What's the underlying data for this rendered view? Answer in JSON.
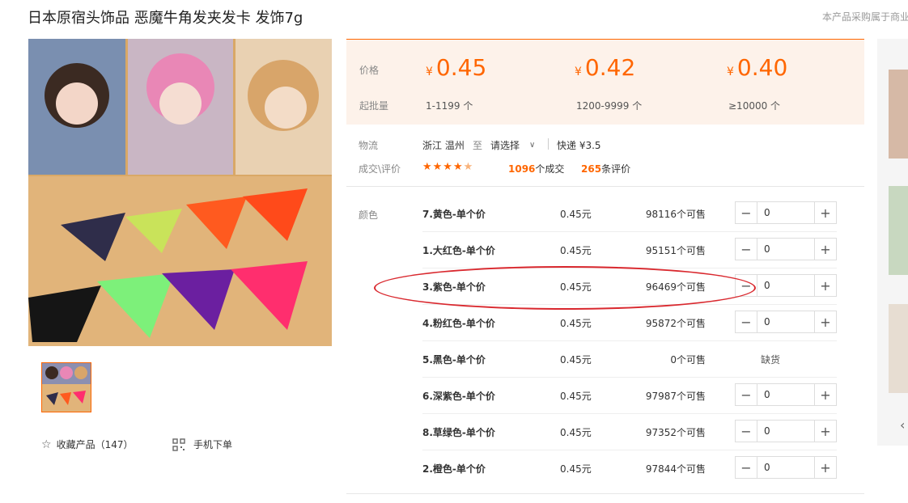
{
  "product": {
    "title": "日本原宿头饰品 恶魔牛角发夹发卡 发饰7g",
    "top_note": "本产品采购属于商业"
  },
  "pricing": {
    "price_label": "价格",
    "moq_label": "起批量",
    "tiers": [
      {
        "currency": "¥",
        "price": "0.45",
        "range": "1-1199 个"
      },
      {
        "currency": "¥",
        "price": "0.42",
        "range": "1200-9999 个"
      },
      {
        "currency": "¥",
        "price": "0.40",
        "range": "≥10000 个"
      }
    ]
  },
  "logistics": {
    "label": "物流",
    "from": "浙江 温州",
    "to_word": "至",
    "select_placeholder": "请选择",
    "shipping": "快递 ¥3.5"
  },
  "reviews": {
    "label": "成交\\评价",
    "rating_stars": 4.5,
    "deals_count": "1096",
    "deals_suffix": "个成交",
    "review_count": "265",
    "review_suffix": "条评价"
  },
  "variants": {
    "label": "颜色",
    "items": [
      {
        "name": "7.黄色-单个价",
        "price": "0.45元",
        "stock": "98116个可售",
        "qty": "0",
        "soldout": ""
      },
      {
        "name": "1.大红色-单个价",
        "price": "0.45元",
        "stock": "95151个可售",
        "qty": "0",
        "soldout": ""
      },
      {
        "name": "3.紫色-单个价",
        "price": "0.45元",
        "stock": "96469个可售",
        "qty": "0",
        "soldout": ""
      },
      {
        "name": "4.粉红色-单个价",
        "price": "0.45元",
        "stock": "95872个可售",
        "qty": "0",
        "soldout": ""
      },
      {
        "name": "5.黑色-单个价",
        "price": "0.45元",
        "stock": "0个可售",
        "qty": "",
        "soldout": "缺货"
      },
      {
        "name": "6.深紫色-单个价",
        "price": "0.45元",
        "stock": "97987个可售",
        "qty": "0",
        "soldout": ""
      },
      {
        "name": "8.草绿色-单个价",
        "price": "0.45元",
        "stock": "97352个可售",
        "qty": "0",
        "soldout": ""
      },
      {
        "name": "2.橙色-单个价",
        "price": "0.45元",
        "stock": "97844个可售",
        "qty": "0",
        "soldout": ""
      }
    ]
  },
  "actions": {
    "favorite": "收藏产品（147）",
    "mobile_order": "手机下单"
  },
  "colors": {
    "accent": "#ff6600",
    "price_bg": "#fdf2ea",
    "annotation": "#d9282e"
  }
}
